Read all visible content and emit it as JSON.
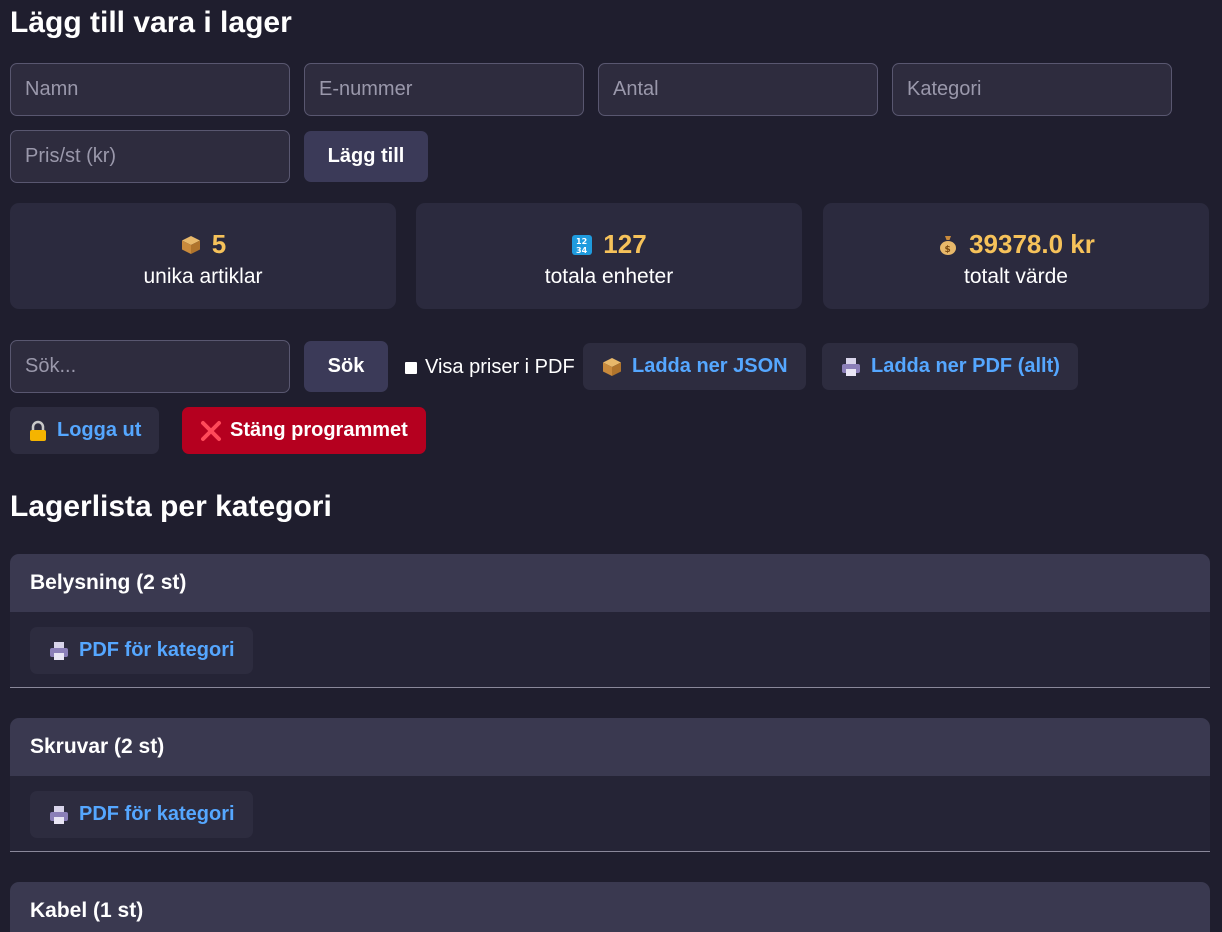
{
  "form": {
    "title": "Lägg till vara i lager",
    "name_placeholder": "Namn",
    "enumber_placeholder": "E-nummer",
    "quantity_placeholder": "Antal",
    "category_placeholder": "Kategori",
    "price_placeholder": "Pris/st (kr)",
    "add_label": "Lägg till"
  },
  "stats": [
    {
      "icon": "package-icon",
      "value": "5",
      "label": "unika artiklar"
    },
    {
      "icon": "numbers-icon",
      "value": "127",
      "label": "totala enheter"
    },
    {
      "icon": "money-bag-icon",
      "value": "39378.0 kr",
      "label": "totalt värde"
    }
  ],
  "toolbar": {
    "search_placeholder": "Sök...",
    "search_label": "Sök",
    "show_prices_label": "Visa priser i PDF",
    "download_json_label": "Ladda ner JSON",
    "download_pdf_label": "Ladda ner PDF (allt)",
    "logout_label": "Logga ut",
    "close_label": "Stäng programmet"
  },
  "list": {
    "title": "Lagerlista per kategori",
    "pdf_category_label": "PDF för kategori",
    "categories": [
      {
        "label": "Belysning (2 st)"
      },
      {
        "label": "Skruvar (2 st)"
      },
      {
        "label": "Kabel (1 st)"
      }
    ]
  },
  "colors": {
    "background": "#1f1e2e",
    "accent_value": "#f6c25a",
    "link_blue": "#55a7ff",
    "danger": "#b5001f"
  }
}
